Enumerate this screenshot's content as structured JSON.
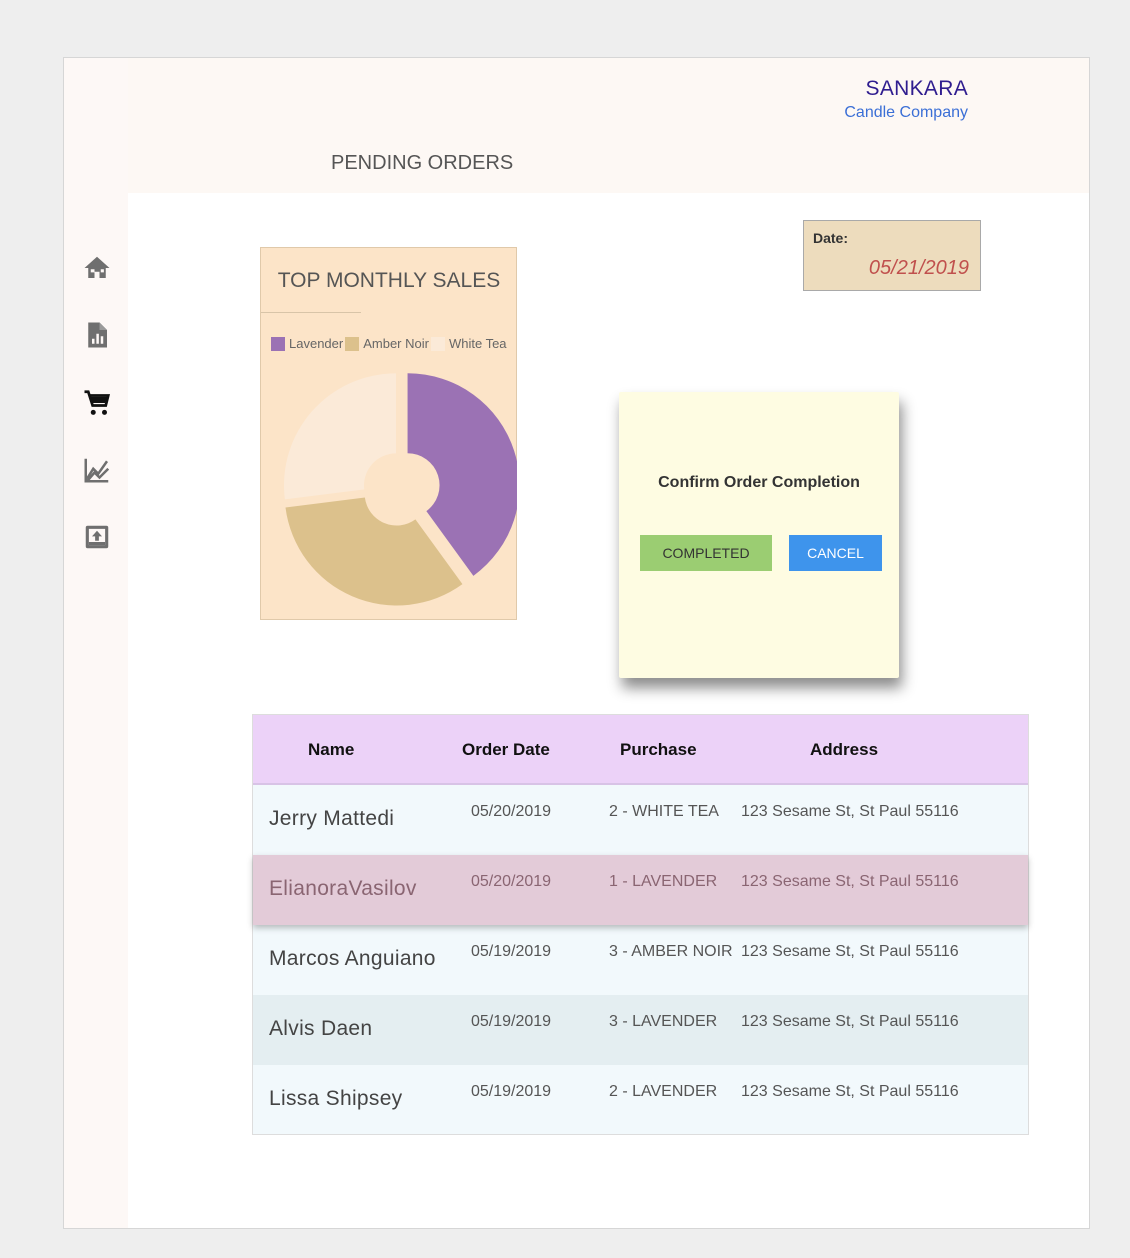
{
  "brand": {
    "name": "SANKARA",
    "subtitle": "Candle Company"
  },
  "page": {
    "title": "PENDING ORDERS"
  },
  "nav": [
    {
      "icon": "home-icon",
      "active": false
    },
    {
      "icon": "report-icon",
      "active": false
    },
    {
      "icon": "cart-icon",
      "active": true
    },
    {
      "icon": "line-chart-icon",
      "active": false
    },
    {
      "icon": "upload-icon",
      "active": false
    }
  ],
  "date": {
    "label": "Date:",
    "value": "05/21/2019"
  },
  "chart_data": {
    "type": "pie",
    "title": "TOP MONTHLY SALES",
    "categories": [
      "Lavender",
      "Amber Noir",
      "White Tea"
    ],
    "values": [
      40,
      33,
      27
    ],
    "colors": [
      "#9b72b4",
      "#dcc18c",
      "#fbead8"
    ],
    "legend_position": "top"
  },
  "modal": {
    "message": "Confirm Order Completion",
    "confirm_label": "COMPLETED",
    "cancel_label": "CANCEL"
  },
  "table": {
    "headers": [
      "Name",
      "Order Date",
      "Purchase",
      "Address"
    ],
    "rows": [
      {
        "name": "Jerry Mattedi",
        "date": "05/20/2019",
        "purchase": "2 - WHITE TEA",
        "address": "123 Sesame St, St Paul 55116"
      },
      {
        "name": "ElianoraVasilov",
        "date": "05/20/2019",
        "purchase": "1 - LAVENDER",
        "address": "123 Sesame St, St Paul 55116"
      },
      {
        "name": "Marcos Anguiano",
        "date": "05/19/2019",
        "purchase": "3 - AMBER NOIR",
        "address": "123 Sesame St, St Paul 55116"
      },
      {
        "name": "Alvis Daen",
        "date": "05/19/2019",
        "purchase": "3 - LAVENDER",
        "address": "123 Sesame St, St Paul 55116"
      },
      {
        "name": "Lissa Shipsey",
        "date": "05/19/2019",
        "purchase": "2 - LAVENDER",
        "address": "123 Sesame St, St Paul 55116"
      }
    ]
  }
}
